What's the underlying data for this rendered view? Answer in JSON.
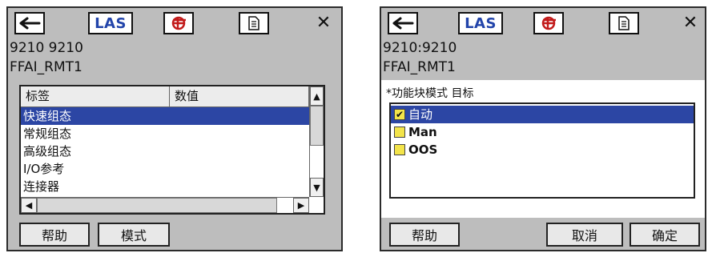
{
  "left": {
    "toolbar": {
      "las": "LAS",
      "close": "✕"
    },
    "tag_line": "9210  9210",
    "device_name": "FFAI_RMT1",
    "table": {
      "headers": [
        "标签",
        "数值"
      ],
      "rows": [
        "快速组态",
        "常规组态",
        "高级组态",
        "I/O参考",
        "连接器"
      ]
    },
    "buttons": {
      "help": "帮助",
      "mode": "模式"
    }
  },
  "right": {
    "toolbar": {
      "las": "LAS",
      "close": "✕"
    },
    "tag_line": "9210:9210",
    "device_name": "FFAI_RMT1",
    "section_label": "*功能块模式 目标",
    "options": [
      {
        "label": "自动",
        "checked": true
      },
      {
        "label": "Man",
        "checked": false
      },
      {
        "label": "OOS",
        "checked": false
      }
    ],
    "buttons": {
      "help": "帮助",
      "cancel": "取消",
      "ok": "确定"
    }
  },
  "colors": {
    "selection": "#2c46a4",
    "check_yellow": "#f3e44a",
    "device_bg": "#bdbdbd"
  }
}
